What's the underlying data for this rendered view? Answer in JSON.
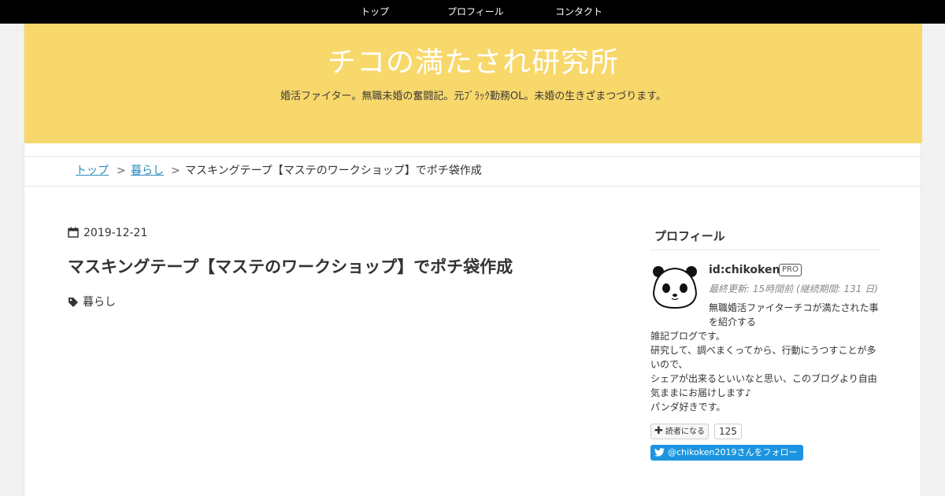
{
  "nav": {
    "items": [
      "トップ",
      "プロフィール",
      "コンタクト"
    ]
  },
  "header": {
    "title": "チコの満たされ研究所",
    "description": "婚活ファイター。無職未婚の奮闘記。元ﾌﾞﾗｯｸ勤務OL。未婚の生きざまつづります。",
    "background": "#f8d86b"
  },
  "breadcrumb": {
    "home": "トップ",
    "sep": ">",
    "category": "暮らし",
    "current": "マスキングテープ【マステのワークショップ】でポチ袋作成"
  },
  "article": {
    "date": "2019-12-21",
    "title": "マスキングテープ【マステのワークショップ】でポチ袋作成",
    "category": "暮らし",
    "date_icon": "calendar-icon",
    "category_icon": "tag-icon"
  },
  "sidebar": {
    "profile_heading": "プロフィール",
    "user_id": "id:chikoken",
    "pro_badge": "PRO",
    "updated": "最終更新: 15時間前 (継続期間: 131 日)",
    "bio_first": "無職婚活ファイターチコが満たされた事を紹介する",
    "bio_lines": [
      "雑記ブログです。",
      "研究して、調べまくってから、行動にうつすことが多",
      "いので、",
      "シェアが出来るといいなと思い、このブログより自由",
      "気ままにお届けします♪",
      "パンダ好きです。"
    ],
    "reader_button": "読者になる",
    "reader_count": "125",
    "twitter_button": "@chikoken2019さんをフォロー",
    "twitter_color": "#1b95e0",
    "avatar_icon": "panda-avatar-icon"
  }
}
